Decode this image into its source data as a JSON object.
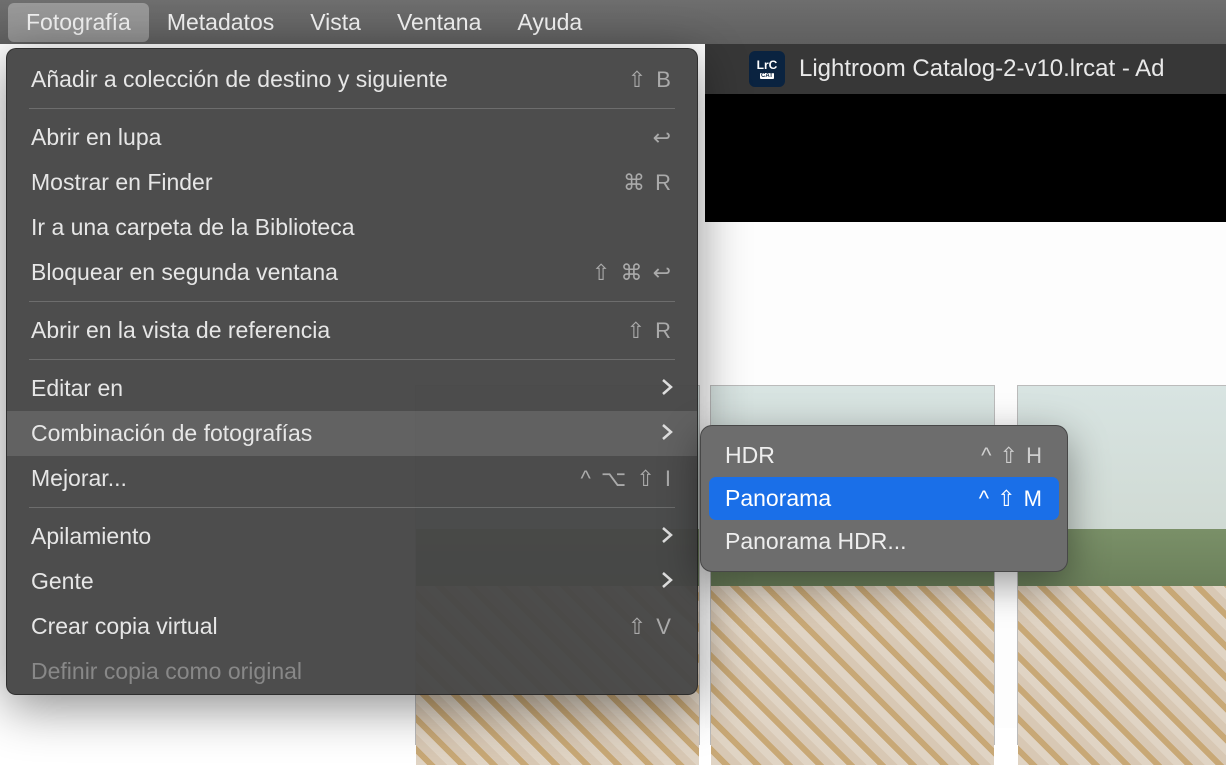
{
  "menubar": {
    "items": [
      {
        "label": "Fotografía",
        "active": true
      },
      {
        "label": "Metadatos"
      },
      {
        "label": "Vista"
      },
      {
        "label": "Ventana"
      },
      {
        "label": "Ayuda"
      }
    ]
  },
  "window": {
    "title": "Lightroom Catalog-2-v10.lrcat - Ad",
    "icon_top": "LrC",
    "icon_bottom": "CAT"
  },
  "menu": {
    "items": [
      {
        "label": "Añadir a colección de destino y siguiente",
        "shortcut": "⇧ B"
      },
      {
        "sep": true
      },
      {
        "label": "Abrir en lupa",
        "shortcut": "↩"
      },
      {
        "label": "Mostrar en Finder",
        "shortcut": "⌘ R"
      },
      {
        "label": "Ir a una carpeta de la Biblioteca"
      },
      {
        "label": "Bloquear en segunda ventana",
        "shortcut": "⇧ ⌘ ↩"
      },
      {
        "sep": true
      },
      {
        "label": "Abrir en la vista de referencia",
        "shortcut": "⇧ R"
      },
      {
        "sep": true
      },
      {
        "label": "Editar en",
        "submenu": true
      },
      {
        "label": "Combinación de fotografías",
        "submenu": true,
        "highlighted": true
      },
      {
        "label": "Mejorar...",
        "shortcut": "^ ⌥ ⇧ I"
      },
      {
        "sep": true
      },
      {
        "label": "Apilamiento",
        "submenu": true
      },
      {
        "label": "Gente",
        "submenu": true
      },
      {
        "label": "Crear copia virtual",
        "shortcut": "⇧ V"
      },
      {
        "label": "Definir copia como original",
        "disabled": true
      }
    ]
  },
  "submenu": {
    "items": [
      {
        "label": "HDR",
        "shortcut": "^ ⇧ H"
      },
      {
        "label": "Panorama",
        "shortcut": "^ ⇧ M",
        "selected": true
      },
      {
        "label": "Panorama HDR..."
      }
    ]
  }
}
